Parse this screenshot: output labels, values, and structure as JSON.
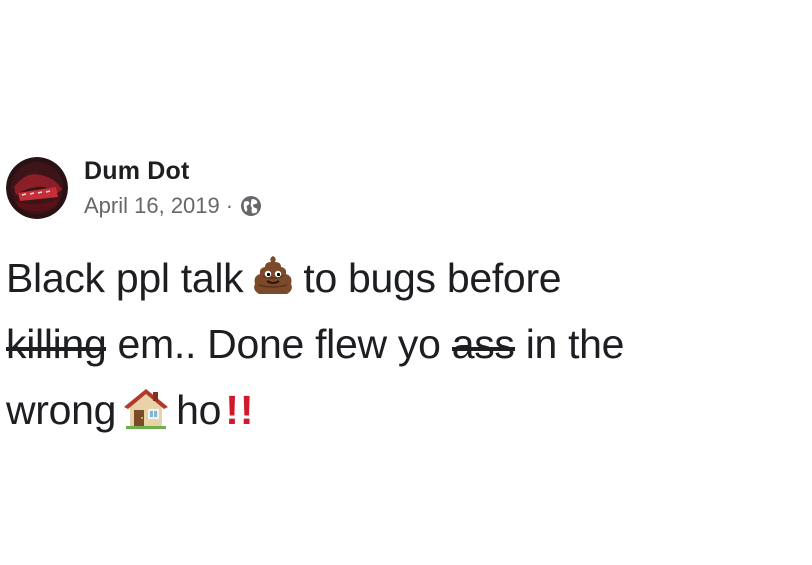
{
  "post": {
    "author": "Dum Dot",
    "date": "April 16, 2019",
    "separator": "·",
    "privacy_icon": "globe-icon",
    "text": {
      "line1_part1": "Black ppl talk",
      "emoji1": "poop-emoji",
      "line1_part2": "to bugs before",
      "line2_strike1": "killing",
      "line2_part1": "em.. Done flew yo",
      "line2_strike2": "ass",
      "line2_part2": "in the",
      "line3_part1": "wrong",
      "emoji2": "house-emoji",
      "line3_part2": "ho",
      "line3_bang": "!!"
    }
  },
  "colors": {
    "text": "#1c1e21",
    "secondary": "#65676b",
    "bang": "#d0192b",
    "background": "#ffffff"
  }
}
